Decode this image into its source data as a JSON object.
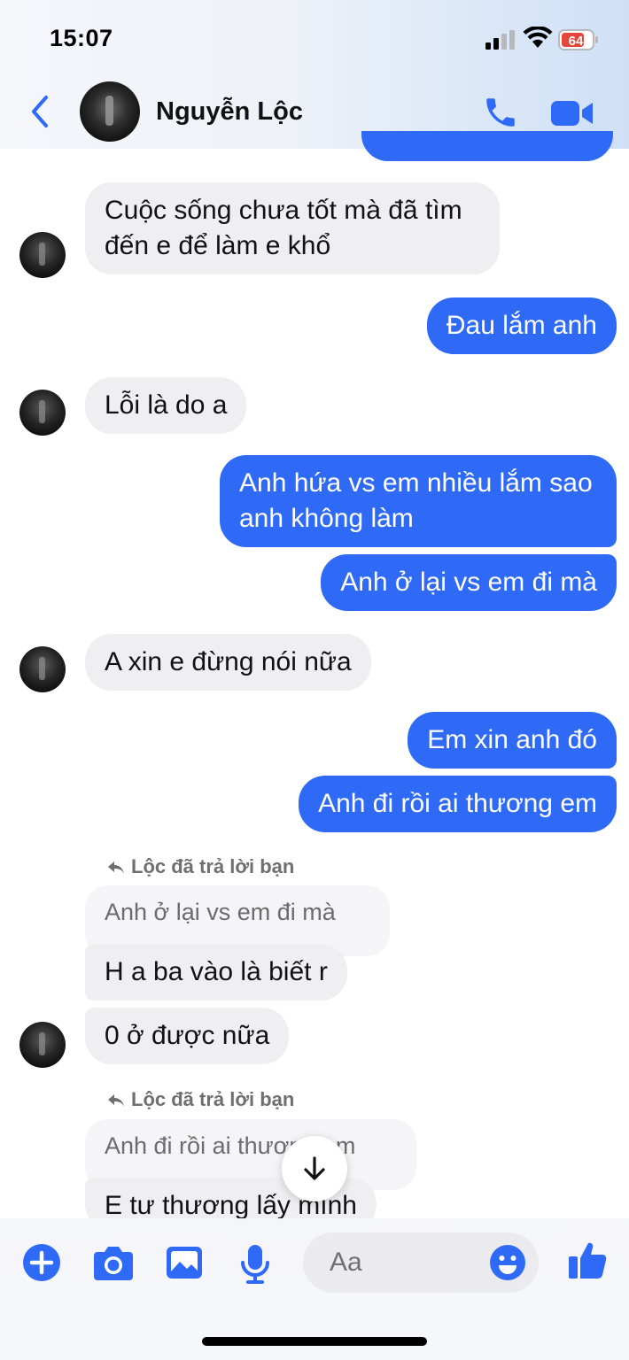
{
  "status_bar": {
    "time": "15:07",
    "battery_level": "64"
  },
  "header": {
    "contact_name": "Nguyễn Lộc"
  },
  "messages": {
    "m1": "Cuộc sống chưa tốt mà đã tìm đến e để làm e khổ",
    "m2": "Đau lắm anh",
    "m3": "Lỗi là do a",
    "m4": "Anh hứa vs em nhiều lắm sao anh không làm",
    "m5": "Anh ở lại vs em đi mà",
    "m6": "A xin e đừng nói nữa",
    "m7": "Em xin anh đó",
    "m8": "Anh đi rồi ai thương em",
    "reply1_label": "Lộc đã trả lời bạn",
    "reply1_quote": "Anh ở lại vs em đi mà",
    "m9": "H a ba vào là biết r",
    "m10": "0 ở được nữa",
    "reply2_label": "Lộc đã trả lời bạn",
    "reply2_quote": "Anh đi rồi ai thương em",
    "m11": "E tư thương lấy mình"
  },
  "composer": {
    "placeholder": "Aa"
  },
  "colors": {
    "accent": "#2f6af6",
    "incoming_bubble": "#efeff2",
    "outgoing_bubble": "#2f6af6"
  },
  "icons": [
    "back-icon",
    "phone-icon",
    "video-icon",
    "plus-icon",
    "camera-icon",
    "gallery-icon",
    "microphone-icon",
    "emoji-icon",
    "thumbs-up-icon",
    "arrow-down-icon",
    "reply-icon"
  ]
}
